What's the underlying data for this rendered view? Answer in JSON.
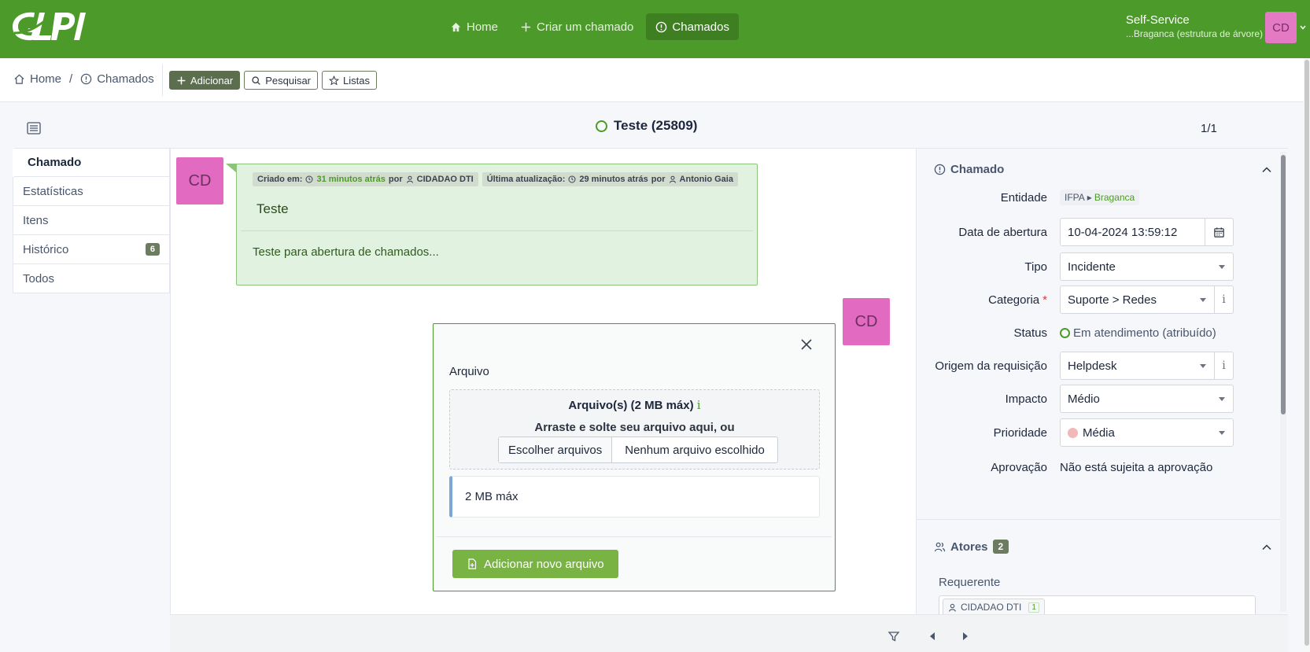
{
  "header": {
    "nav": [
      {
        "label": "Home",
        "icon": "home-icon"
      },
      {
        "label": "Criar um chamado",
        "icon": "plus-icon"
      },
      {
        "label": "Chamados",
        "icon": "alert-circle-icon",
        "active": true
      }
    ],
    "profile": "Self-Service",
    "entity": "...Braganca (estrutura de árvore)",
    "avatar_initials": "CD"
  },
  "breadcrumb": {
    "home": "Home",
    "current": "Chamados"
  },
  "actions": {
    "add": "Adicionar",
    "search": "Pesquisar",
    "lists": "Listas"
  },
  "ticket": {
    "title": "Teste (25809)",
    "pager": "1/1"
  },
  "tabs": [
    {
      "label": "Chamado"
    },
    {
      "label": "Estatísticas"
    },
    {
      "label": "Itens"
    },
    {
      "label": "Histórico",
      "badge": "6"
    },
    {
      "label": "Todos"
    }
  ],
  "timeline": {
    "avatar_initials": "CD",
    "followup": {
      "created_label": "Criado em:",
      "created_time": "31 minutos atrás",
      "by": "por",
      "created_user": "CIDADAO DTI",
      "updated_label": "Última atualização:",
      "updated_time": "29 minutos atrás",
      "updated_user": "Antonio Gaia",
      "title": "Teste",
      "body": "Teste para abertura de chamados..."
    },
    "document_form": {
      "label": "Arquivo",
      "dropzone_title": "Arquivo(s) (2 MB máx)",
      "info_glyph": "i",
      "dropzone_hint": "Arraste e solte seu arquivo aqui, ou",
      "choose_button": "Escolher arquivos",
      "no_file_text": "Nenhum arquivo escolhido",
      "max_note": "2 MB máx",
      "submit": "Adicionar novo arquivo"
    }
  },
  "side": {
    "ticket_card": {
      "title": "Chamado",
      "fields": {
        "entity_label": "Entidade",
        "entity_root": "IFPA",
        "entity_leaf": "Braganca",
        "date_label": "Data de abertura",
        "date_value": "10-04-2024 13:59:12",
        "type_label": "Tipo",
        "type_value": "Incidente",
        "category_label": "Categoria",
        "category_value": "Suporte > Redes",
        "status_label": "Status",
        "status_value": "Em atendimento (atribuído)",
        "origin_label": "Origem da requisição",
        "origin_value": "Helpdesk",
        "impact_label": "Impacto",
        "impact_value": "Médio",
        "priority_label": "Prioridade",
        "priority_value": "Média",
        "approval_label": "Aprovação",
        "approval_value": "Não está sujeita a aprovação"
      }
    },
    "actors_card": {
      "title": "Atores",
      "count": "2",
      "requester_label": "Requerente",
      "requester": "CIDADAO DTI",
      "requester_count": "1"
    }
  },
  "colors": {
    "brand": "#4c9a2a",
    "avatar": "#e36ac1",
    "followup_bg": "#e2f2e0",
    "add_button": "#78b344"
  }
}
